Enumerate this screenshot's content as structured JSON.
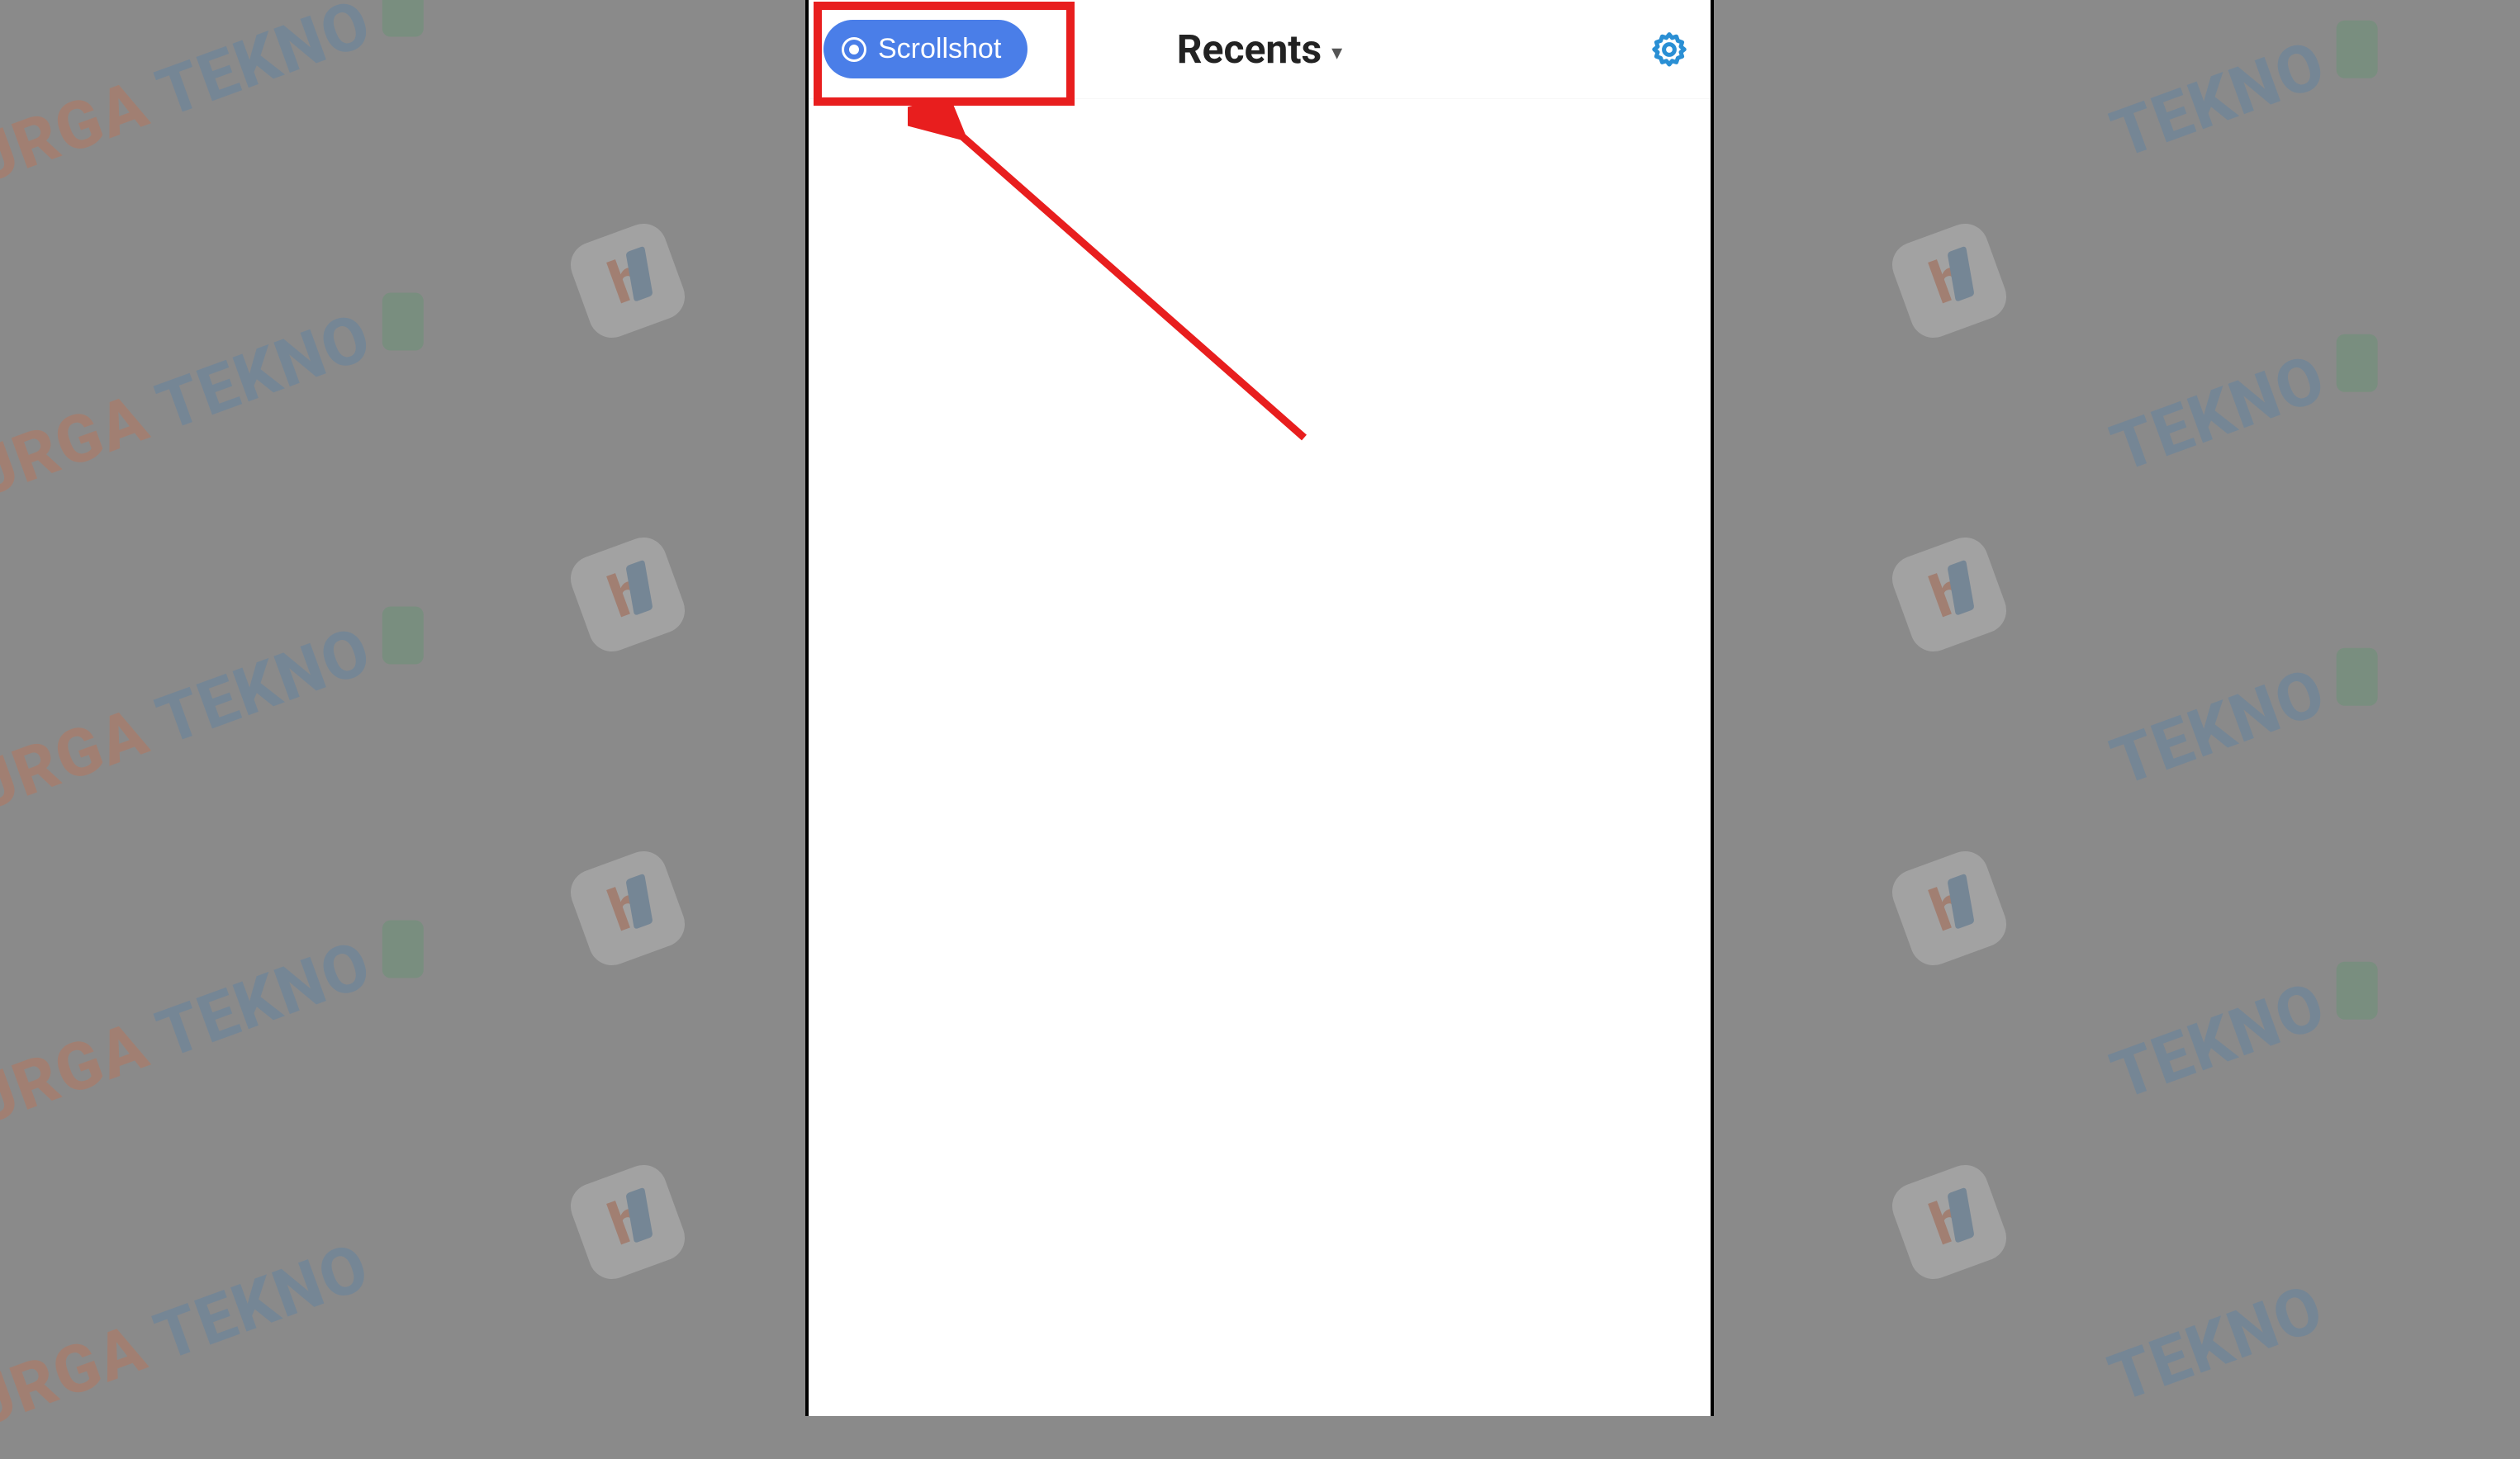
{
  "header": {
    "scrollshot_label": "Scrollshot",
    "title": "Recents",
    "dropdown_marker": "▾"
  },
  "colors": {
    "primary_button": "#4a7ee8",
    "highlight_annotation": "#e81e1e",
    "settings_icon": "#2a8fd4"
  },
  "watermark": {
    "text_part1": "SURGA",
    "text_part2": " TEKNO"
  }
}
